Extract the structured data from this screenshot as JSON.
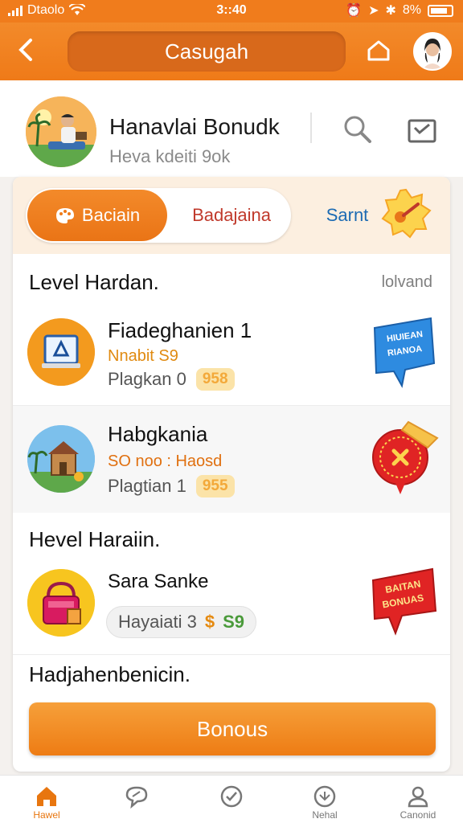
{
  "status_bar": {
    "carrier": "Dtaolo",
    "time": "3::40",
    "battery": "8%"
  },
  "header": {
    "title": "Casugah"
  },
  "profile": {
    "name": "Hanavlai Bonudk",
    "subtitle": "Heva kdeiti 9ok"
  },
  "tabs": [
    {
      "label": "Baciain",
      "active": true
    },
    {
      "label": "Badajaina",
      "active": false
    },
    {
      "label": "Sarnt",
      "active": false
    }
  ],
  "sections": {
    "level": {
      "title": "Level Hardan.",
      "link": "lolvand"
    },
    "hevel": {
      "title": "Hevel Haraiin."
    },
    "footer": {
      "title": "Hadjahenbenicin."
    }
  },
  "rows": [
    {
      "title": "Fiadeghanien 1",
      "subtitle": "Nnabit  S9",
      "meta": "Plagkan 0",
      "badge": "958",
      "sticker_text": [
        "HIUIEAN",
        "RIANOA"
      ]
    },
    {
      "title": "Habgkania",
      "subtitle": "SO noo : Haosd",
      "meta": "Plagtian 1",
      "badge": "955",
      "sticker_text": []
    },
    {
      "title": "Sara Sanke",
      "meta": "Hayaiati 3",
      "money": "$",
      "money2": "S9",
      "sticker_text": [
        "BAITAN",
        "BONUAS"
      ]
    }
  ],
  "bonus_button": {
    "label": "Bonous"
  },
  "bottom_nav": [
    {
      "label": "Hawel",
      "icon": "home-icon",
      "active": true
    },
    {
      "label": "",
      "icon": "chat-icon",
      "active": false
    },
    {
      "label": "",
      "icon": "check-circle-icon",
      "active": false
    },
    {
      "label": "Nehal",
      "icon": "gift-icon",
      "active": false
    },
    {
      "label": "Canonid",
      "icon": "profile-icon",
      "active": false
    }
  ],
  "colors": {
    "accent": "#f07c1c",
    "accent_dark": "#d8691b",
    "tab_tint": "#fcefe0",
    "badge": "#fbe3a8"
  }
}
